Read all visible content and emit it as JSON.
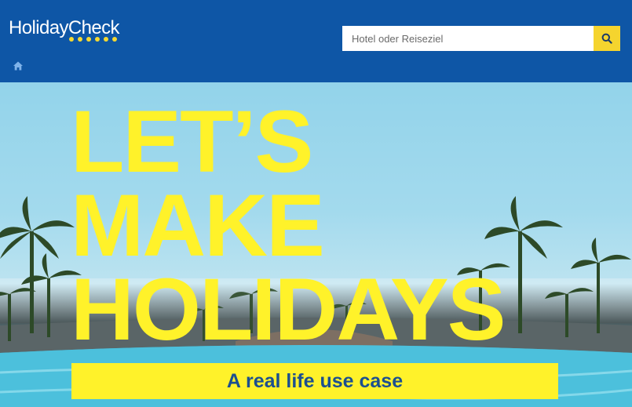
{
  "header": {
    "logo_text": "HolidayCheck",
    "search": {
      "placeholder": "Hotel oder Reiseziel"
    },
    "search_button_icon": "search-icon",
    "home_icon": "home-icon"
  },
  "hero": {
    "headline_line1": "LET’S",
    "headline_line2": "MAKE",
    "headline_line3": "HOLIDAYS",
    "subtitle": "A real life use case"
  },
  "colors": {
    "header_bg": "#0e56a6",
    "accent_yellow": "#fff22a",
    "search_button": "#f5d42e",
    "subtitle_text": "#1c4f8f"
  }
}
